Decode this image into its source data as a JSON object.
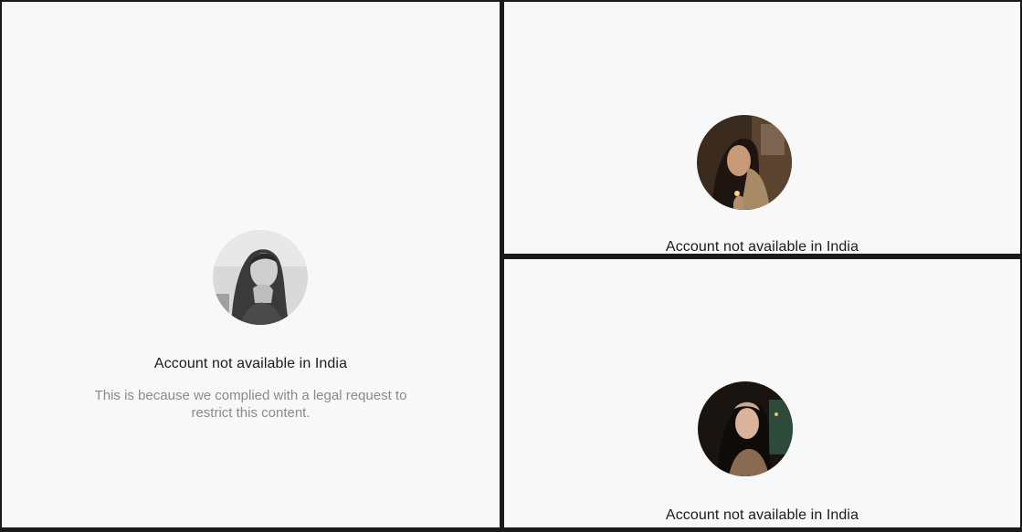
{
  "panels": [
    {
      "title": "Account not available in India",
      "description_line1": "This is because we complied with a legal request to",
      "description_line2": "restrict this content."
    },
    {
      "title": "Account not available in India"
    },
    {
      "title": "Account not available in India"
    }
  ],
  "icons": {
    "avatar_1": "profile-photo-grayscale",
    "avatar_2": "profile-photo-warm",
    "avatar_3": "profile-photo-dark"
  }
}
